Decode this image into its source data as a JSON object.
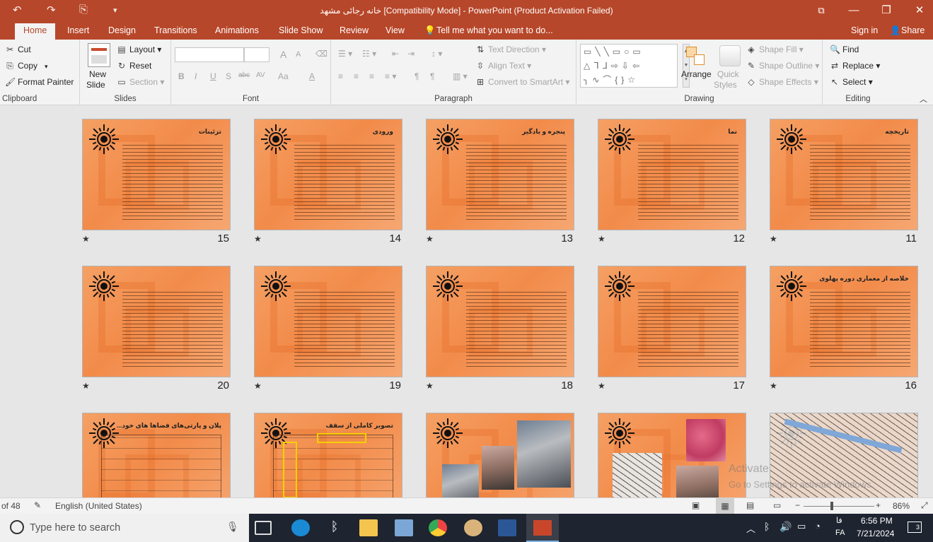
{
  "window": {
    "title": "خانه رجائی مشهد [Compatibility Mode] - PowerPoint (Product Activation Failed)",
    "controls": {
      "ribbon_display": "⧉",
      "minimize": "—",
      "restore": "❐",
      "close": "✕"
    }
  },
  "quick_access": {
    "undo": "↶",
    "redo": "↷",
    "start": "⎘",
    "customize": "▾"
  },
  "tabs": [
    {
      "label": "Home",
      "active": true
    },
    {
      "label": "Insert"
    },
    {
      "label": "Design"
    },
    {
      "label": "Transitions"
    },
    {
      "label": "Animations"
    },
    {
      "label": "Slide Show"
    },
    {
      "label": "Review"
    },
    {
      "label": "View"
    }
  ],
  "tell_me": "Tell me what you want to do...",
  "account": {
    "signin": "Sign in",
    "share": "Share"
  },
  "ribbon": {
    "clipboard": {
      "label": "Clipboard",
      "cut": "Cut",
      "copy": "Copy",
      "format_painter": "Format Painter"
    },
    "slides": {
      "label": "Slides",
      "new_slide": "New",
      "new_slide2": "Slide",
      "layout": "Layout",
      "reset": "Reset",
      "section": "Section"
    },
    "font": {
      "label": "Font",
      "bold": "B",
      "italic": "I",
      "underline": "U",
      "shadow": "S",
      "strike": "abc",
      "spacing": "AV",
      "case": "Aa",
      "color": "A",
      "grow": "A",
      "shrink": "A"
    },
    "paragraph": {
      "label": "Paragraph",
      "text_direction": "Text Direction",
      "align_text": "Align Text",
      "smartart": "Convert to SmartArt"
    },
    "drawing": {
      "label": "Drawing",
      "arrange": "Arrange",
      "quick_styles": "Quick",
      "quick_styles2": "Styles",
      "shape_fill": "Shape Fill",
      "shape_outline": "Shape Outline",
      "shape_effects": "Shape Effects"
    },
    "editing": {
      "label": "Editing",
      "find": "Find",
      "replace": "Replace",
      "select": "Select"
    }
  },
  "slides": [
    {
      "num": "15",
      "title": "تزئینات"
    },
    {
      "num": "14",
      "title": "ورودی"
    },
    {
      "num": "13",
      "title": "پنجره و بادگیر"
    },
    {
      "num": "12",
      "title": "نما"
    },
    {
      "num": "11",
      "title": "تاریخچه"
    },
    {
      "num": "20",
      "title": ""
    },
    {
      "num": "19",
      "title": ""
    },
    {
      "num": "18",
      "title": ""
    },
    {
      "num": "17",
      "title": ""
    },
    {
      "num": "16",
      "title": "خلاصه از معماری دوره پهلوی"
    },
    {
      "num": "",
      "title": "پلان و پارتی‌های فضاها های خود..."
    },
    {
      "num": "",
      "title": "تصویر کاملی از سقف"
    },
    {
      "num": "",
      "title": ""
    },
    {
      "num": "",
      "title": ""
    },
    {
      "num": "",
      "title": ""
    }
  ],
  "star": "★",
  "status": {
    "slide_of": "of 48",
    "language": "English (United States)",
    "zoom": "86%"
  },
  "activate": {
    "line1": "Activate",
    "line2": "Go to Settings to activate Windows."
  },
  "taskbar": {
    "search_placeholder": "Type here to search",
    "lang": "FA",
    "lang2": "فا",
    "time": "6:56 PM",
    "date": "7/21/2024",
    "notifications": "3"
  }
}
